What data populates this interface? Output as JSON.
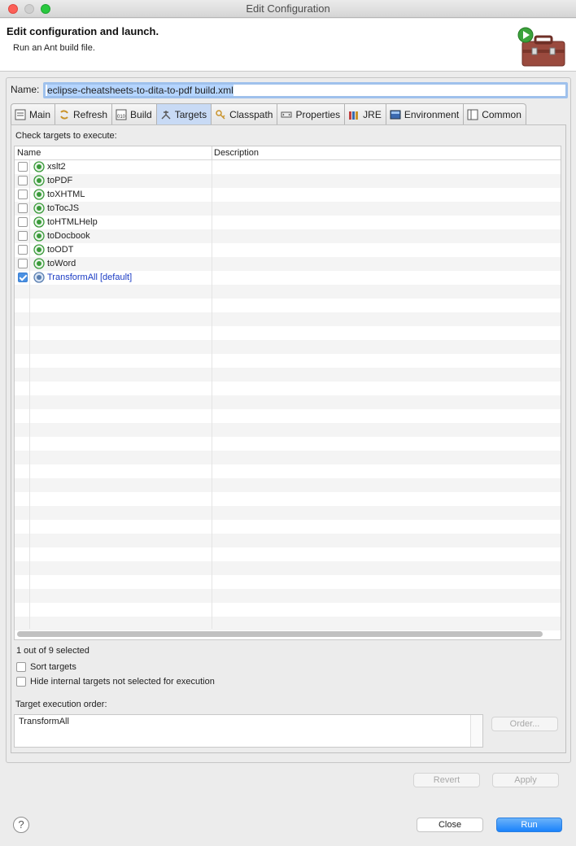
{
  "window": {
    "title": "Edit Configuration"
  },
  "header": {
    "title": "Edit configuration and launch.",
    "subtitle": "Run an Ant build file.",
    "icon": "toolbox-run-icon"
  },
  "name": {
    "label": "Name:",
    "value": "eclipse-cheatsheets-to-dita-to-pdf build.xml"
  },
  "tabs": [
    {
      "label": "Main",
      "icon": "main-icon",
      "active": false
    },
    {
      "label": "Refresh",
      "icon": "refresh-icon",
      "active": false
    },
    {
      "label": "Build",
      "icon": "build-icon",
      "active": false
    },
    {
      "label": "Targets",
      "icon": "targets-icon",
      "active": true
    },
    {
      "label": "Classpath",
      "icon": "classpath-icon",
      "active": false
    },
    {
      "label": "Properties",
      "icon": "properties-icon",
      "active": false
    },
    {
      "label": "JRE",
      "icon": "jre-icon",
      "active": false
    },
    {
      "label": "Environment",
      "icon": "environment-icon",
      "active": false
    },
    {
      "label": "Common",
      "icon": "common-icon",
      "active": false
    }
  ],
  "targets_panel": {
    "check_label": "Check targets to execute:",
    "columns": {
      "name": "Name",
      "description": "Description"
    },
    "targets": [
      {
        "name": "xslt2",
        "checked": false,
        "default": false
      },
      {
        "name": "toPDF",
        "checked": false,
        "default": false
      },
      {
        "name": "toXHTML",
        "checked": false,
        "default": false
      },
      {
        "name": "toTocJS",
        "checked": false,
        "default": false
      },
      {
        "name": "toHTMLHelp",
        "checked": false,
        "default": false
      },
      {
        "name": "toDocbook",
        "checked": false,
        "default": false
      },
      {
        "name": "toODT",
        "checked": false,
        "default": false
      },
      {
        "name": "toWord",
        "checked": false,
        "default": false
      },
      {
        "name": "TransformAll [default]",
        "checked": true,
        "default": true
      }
    ],
    "selection_count": "1 out of 9 selected",
    "sort_targets": "Sort targets",
    "hide_internal": "Hide internal targets not selected for execution",
    "order_label": "Target execution order:",
    "order_value": "TransformAll",
    "order_button": "Order..."
  },
  "buttons": {
    "revert": "Revert",
    "apply": "Apply",
    "close": "Close",
    "run": "Run",
    "help": "?"
  },
  "colors": {
    "accent": "#1a82fb",
    "default_target": "#1a3bc4",
    "target_icon": "#3a9a3a"
  }
}
